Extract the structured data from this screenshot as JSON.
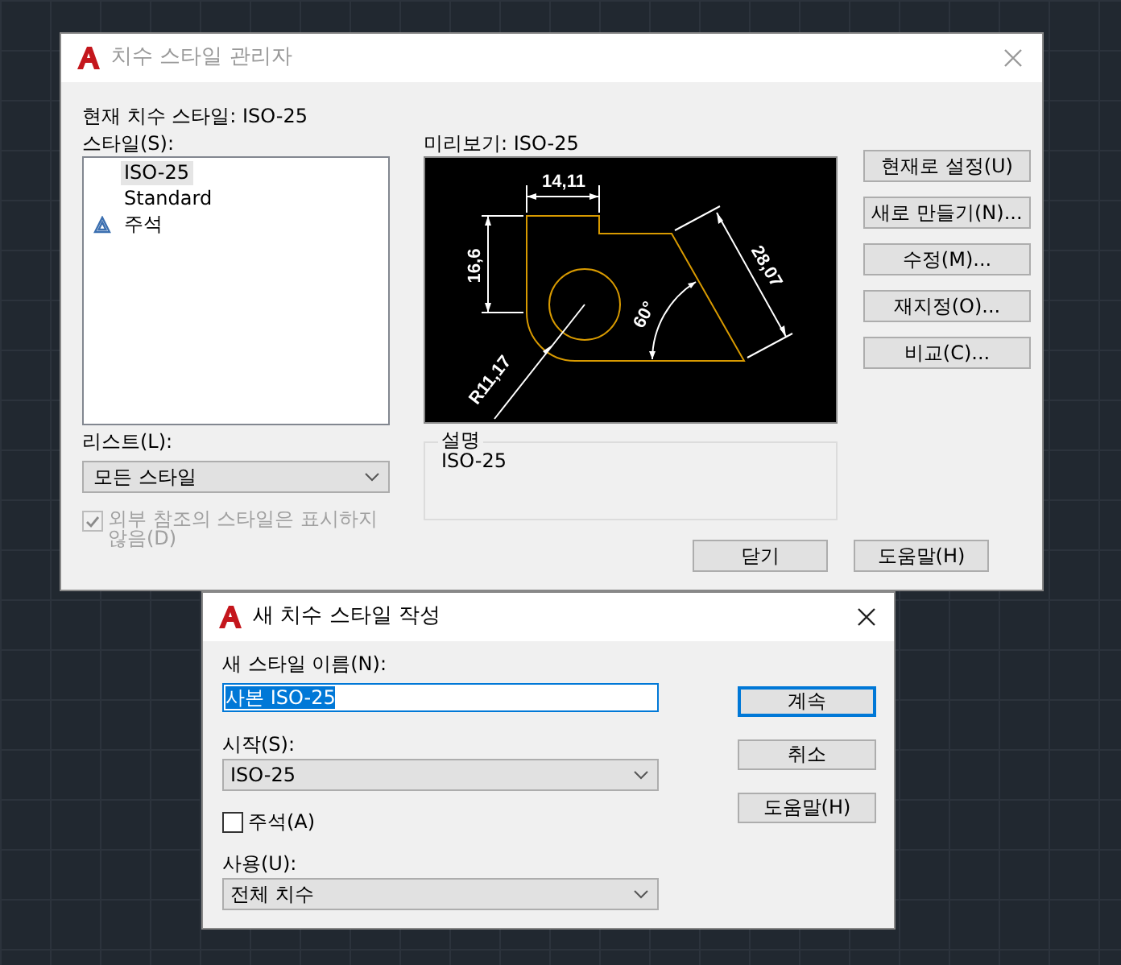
{
  "main_dialog": {
    "title": "치수 스타일 관리자",
    "current_style_label": "현재 치수 스타일: ISO-25",
    "styles_label": "스타일(S):",
    "styles": [
      {
        "name": "ISO-25",
        "selected": true,
        "kind": "plain"
      },
      {
        "name": "Standard",
        "selected": false,
        "kind": "plain"
      },
      {
        "name": "주석",
        "selected": false,
        "kind": "annotative"
      }
    ],
    "list_label": "리스트(L):",
    "list_dropdown": {
      "value": "모든 스타일"
    },
    "xref_checkbox": {
      "label": "외부 참조의 스타일은 표시하지 않음(D)",
      "checked": true,
      "disabled": true
    },
    "preview_label": "미리보기: ISO-25",
    "preview_dimensions": [
      "14,11",
      "16,6",
      "28,07",
      "60°",
      "R11,17"
    ],
    "description": {
      "legend": "설명",
      "text": "ISO-25"
    },
    "side_buttons": [
      "현재로 설정(U)",
      "새로 만들기(N)...",
      "수정(M)...",
      "재지정(O)...",
      "비교(C)..."
    ],
    "bottom_buttons": [
      "닫기",
      "도움말(H)"
    ]
  },
  "new_style_dialog": {
    "title": "새 치수 스타일 작성",
    "name_label": "새 스타일 이름(N):",
    "name_field": {
      "value": "사본 ISO-25",
      "selected": true
    },
    "start_label": "시작(S):",
    "start_dropdown": {
      "value": "ISO-25"
    },
    "annotative_checkbox": {
      "label": "주석(A)",
      "checked": false
    },
    "use_label": "사용(U):",
    "use_dropdown": {
      "value": "전체 치수"
    },
    "buttons": [
      {
        "label": "계속",
        "default": true
      },
      {
        "label": "취소",
        "default": false
      },
      {
        "label": "도움말(H)",
        "default": false
      }
    ]
  }
}
